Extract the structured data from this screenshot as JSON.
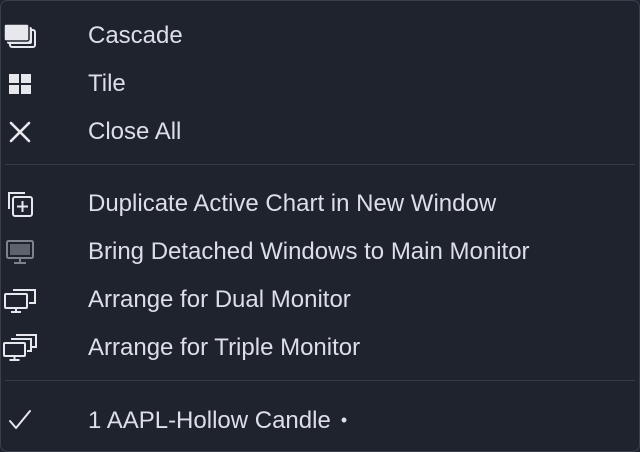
{
  "menu": {
    "group1": [
      {
        "label": "Cascade",
        "icon": "cascade-icon"
      },
      {
        "label": "Tile",
        "icon": "tile-icon"
      },
      {
        "label": "Close All",
        "icon": "close-icon"
      }
    ],
    "group2": [
      {
        "label": "Duplicate Active Chart in New Window",
        "icon": "duplicate-window-icon"
      },
      {
        "label": "Bring Detached Windows to Main Monitor",
        "icon": "monitor-icon"
      },
      {
        "label": "Arrange for Dual Monitor",
        "icon": "dual-monitor-icon"
      },
      {
        "label": "Arrange for Triple Monitor",
        "icon": "triple-monitor-icon"
      }
    ],
    "windows": [
      {
        "label": "1  AAPL-Hollow Candle",
        "marker": "•",
        "icon": "checkmark-icon",
        "checked": true
      }
    ]
  },
  "colors": {
    "background": "#1f232e",
    "text": "#dcdfe6",
    "icon": "#e6e8ee",
    "icon_disabled": "#7d828d",
    "divider": "#363a45"
  }
}
